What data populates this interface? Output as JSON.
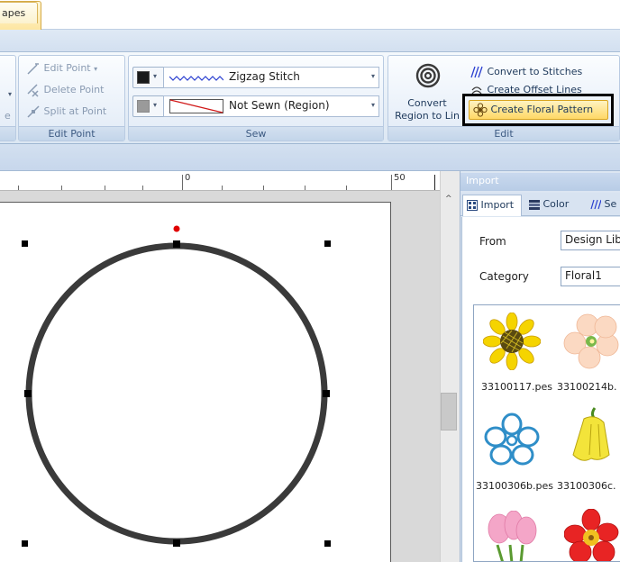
{
  "tabs": {
    "top_tab_label": "apes",
    "context_tab_label": "apes"
  },
  "ribbon": {
    "edit_point_group": {
      "label": "Edit Point",
      "edit_point": "Edit Point",
      "delete_point": "Delete Point",
      "split_at_point": "Split at Point",
      "cut_left_1": "e"
    },
    "sew_group": {
      "label": "Sew",
      "line_stitch": "Zigzag Stitch",
      "region_stitch": "Not Sewn (Region)",
      "line_color": "#1a1a1a",
      "region_color": "#9a9a9a"
    },
    "edit_group": {
      "label": "Edit",
      "convert_region_line1": "Convert",
      "convert_region_line2": "Region to Lin",
      "convert_to_stitches": "Convert to Stitches",
      "create_offset_lines": "Create Offset Lines",
      "create_floral_pattern": "Create Floral Pattern"
    }
  },
  "ruler": {
    "label_0": "0",
    "label_50": "50"
  },
  "import_panel": {
    "title": "Import",
    "tabs": [
      "Import",
      "Color",
      "Se"
    ],
    "from_label": "From",
    "from_value": "Design Lib",
    "category_label": "Category",
    "category_value": "Floral1",
    "items": [
      "33100117.pes",
      "33100214b.",
      "33100306b.pes",
      "33100306c."
    ]
  },
  "colors": {
    "highlight_border": "#000000",
    "selection_handle": "#000000",
    "rotation_handle": "#e00000",
    "shape_stroke": "#3a3a3a"
  }
}
